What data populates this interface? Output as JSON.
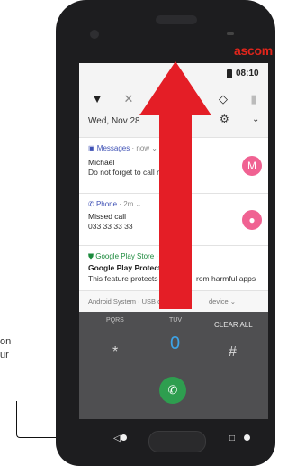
{
  "callout": {
    "line1": "on",
    "line2": "ur"
  },
  "device": {
    "brand": "ascom"
  },
  "status": {
    "time": "08:10"
  },
  "quick_settings": {
    "date": "Wed, Nov 28",
    "icons": [
      "wifi-icon",
      "bluetooth-off-icon",
      "dnd-icon",
      "rotate-icon",
      "battery-saver-icon"
    ]
  },
  "notifications": [
    {
      "app": "Messages",
      "meta": "· now ⌄",
      "title": "Michael",
      "body": "Do not forget to call me",
      "avatar": "M"
    },
    {
      "app": "Phone",
      "meta": "· 2m ⌄",
      "title": "Missed call",
      "body": "033 33 33 33"
    },
    {
      "app": "Google Play Store",
      "meta": "· 2h",
      "title": "Google Play Protect is tu",
      "body": "This feature protects yo",
      "body_tail": "rom harmful apps"
    }
  ],
  "system_row": {
    "text": "Android System · USB c",
    "tail": "device ⌄"
  },
  "dialpad": {
    "label_left": "PQRS",
    "label_mid": "TUV",
    "clear_all": "CLEAR ALL",
    "star": "*",
    "zero": "0",
    "hash": "#"
  },
  "colors": {
    "arrow": "#e41e26",
    "brand": "#e1251b",
    "avatar_messages": "#f06292",
    "avatar_phone": "#f06292",
    "call": "#2e9e4f"
  }
}
